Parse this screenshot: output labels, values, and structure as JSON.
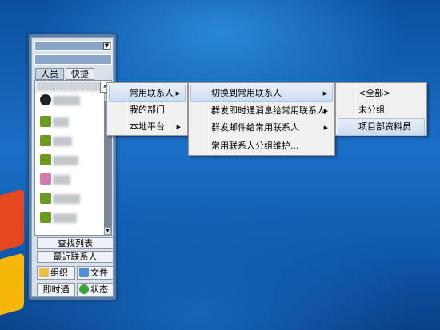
{
  "window": {
    "tabs": [
      "人员",
      "快捷"
    ],
    "list_arrow": "»",
    "buttons": {
      "find_list": "查找列表",
      "recent": "最近联系人",
      "org": "组织",
      "file": "文件",
      "im": "即时通",
      "status": "状态"
    },
    "contacts": [
      {
        "icon": "avatar-photo-icon",
        "color": "#333333"
      },
      {
        "icon": "user-green-icon",
        "color": "#6b9a1f"
      },
      {
        "icon": "user-green-icon",
        "color": "#6b9a1f"
      },
      {
        "icon": "user-green-icon",
        "color": "#6b9a1f"
      },
      {
        "icon": "user-pink-icon",
        "color": "#d07ab0"
      },
      {
        "icon": "user-green-icon",
        "color": "#6b9a1f"
      },
      {
        "icon": "user-green-icon",
        "color": "#6b9a1f"
      }
    ]
  },
  "menu1": {
    "items": [
      "常用联系人",
      "我的部门",
      "本地平台"
    ]
  },
  "menu2": {
    "items": [
      "切换到常用联系人",
      "群发即时通消息给常用联系人",
      "群发邮件给常用联系人",
      "常用联系人分组维护..."
    ]
  },
  "menu3": {
    "items": [
      "<全部>",
      "未分组",
      "项目部资料员"
    ]
  },
  "colors": {
    "highlight": "#cadcf1",
    "desktop": "#1a6fc7"
  }
}
